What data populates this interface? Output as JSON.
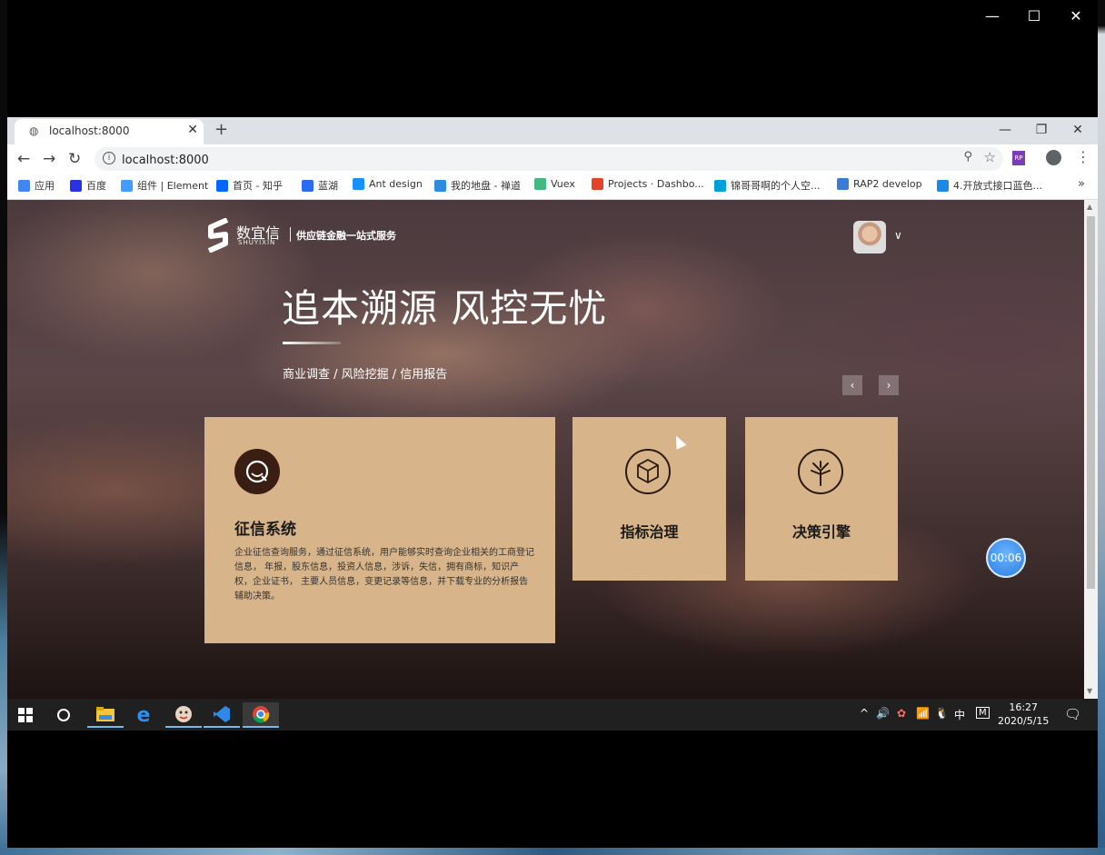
{
  "outer_window": {
    "minimize": "—",
    "maximize": "☐",
    "close": "✕"
  },
  "tab": {
    "title": "localhost:8000",
    "close": "✕",
    "new_tab": "+"
  },
  "browser_window": {
    "minimize": "—",
    "restore": "❐",
    "close": "✕"
  },
  "toolbar": {
    "back": "←",
    "forward": "→",
    "reload": "↻",
    "url": "localhost:8000",
    "menu": "⋮",
    "extension": "RP"
  },
  "bookmarks": [
    {
      "label": "应用",
      "color": "#4285f4"
    },
    {
      "label": "百度",
      "color": "#2932e1"
    },
    {
      "label": "组件 | Element",
      "color": "#409eff"
    },
    {
      "label": "首页 - 知乎",
      "color": "#0066ff"
    },
    {
      "label": "蓝湖",
      "color": "#2a6bf2"
    },
    {
      "label": "Ant design",
      "color": "#1890ff"
    },
    {
      "label": "我的地盘 - 禅道",
      "color": "#2c8de0"
    },
    {
      "label": "Vuex",
      "color": "#42b883"
    },
    {
      "label": "Projects · Dashbo...",
      "color": "#e24329"
    },
    {
      "label": "锦哥哥啊的个人空...",
      "color": "#00a1d6"
    },
    {
      "label": "RAP2 develop",
      "color": "#3a7bd5"
    },
    {
      "label": "4.开放式接口蓝色...",
      "color": "#1e88e5"
    }
  ],
  "bookmarks_more": "»",
  "site": {
    "logo_text": "数宜信",
    "logo_sub": "SHUYIXIN",
    "slogan": "供应链金融一站式服务",
    "hero_title": "追本溯源 风控无忧",
    "hero_sub": "商业调查 / 风险挖掘 / 信用报告",
    "prev": "‹",
    "next": "›",
    "cards": [
      {
        "title": "征信系统",
        "desc": "企业征信查询服务，通过征信系统，用户能够实时查询企业相关的工商登记信息， 年报，股东信息，投资人信息，涉诉，失信，拥有商标，知识产权，企业证书， 主要人员信息，变更记录等信息，并下载专业的分析报告辅助决策。"
      },
      {
        "title": "指标治理"
      },
      {
        "title": "决策引擎"
      }
    ],
    "timer": "00:06"
  },
  "taskbar": {
    "tray_items": [
      "^",
      "🔊",
      "✿",
      "📶",
      "🐧",
      "中",
      "M"
    ],
    "time": "16:27",
    "date": "2020/5/15",
    "notif": "🗨"
  }
}
